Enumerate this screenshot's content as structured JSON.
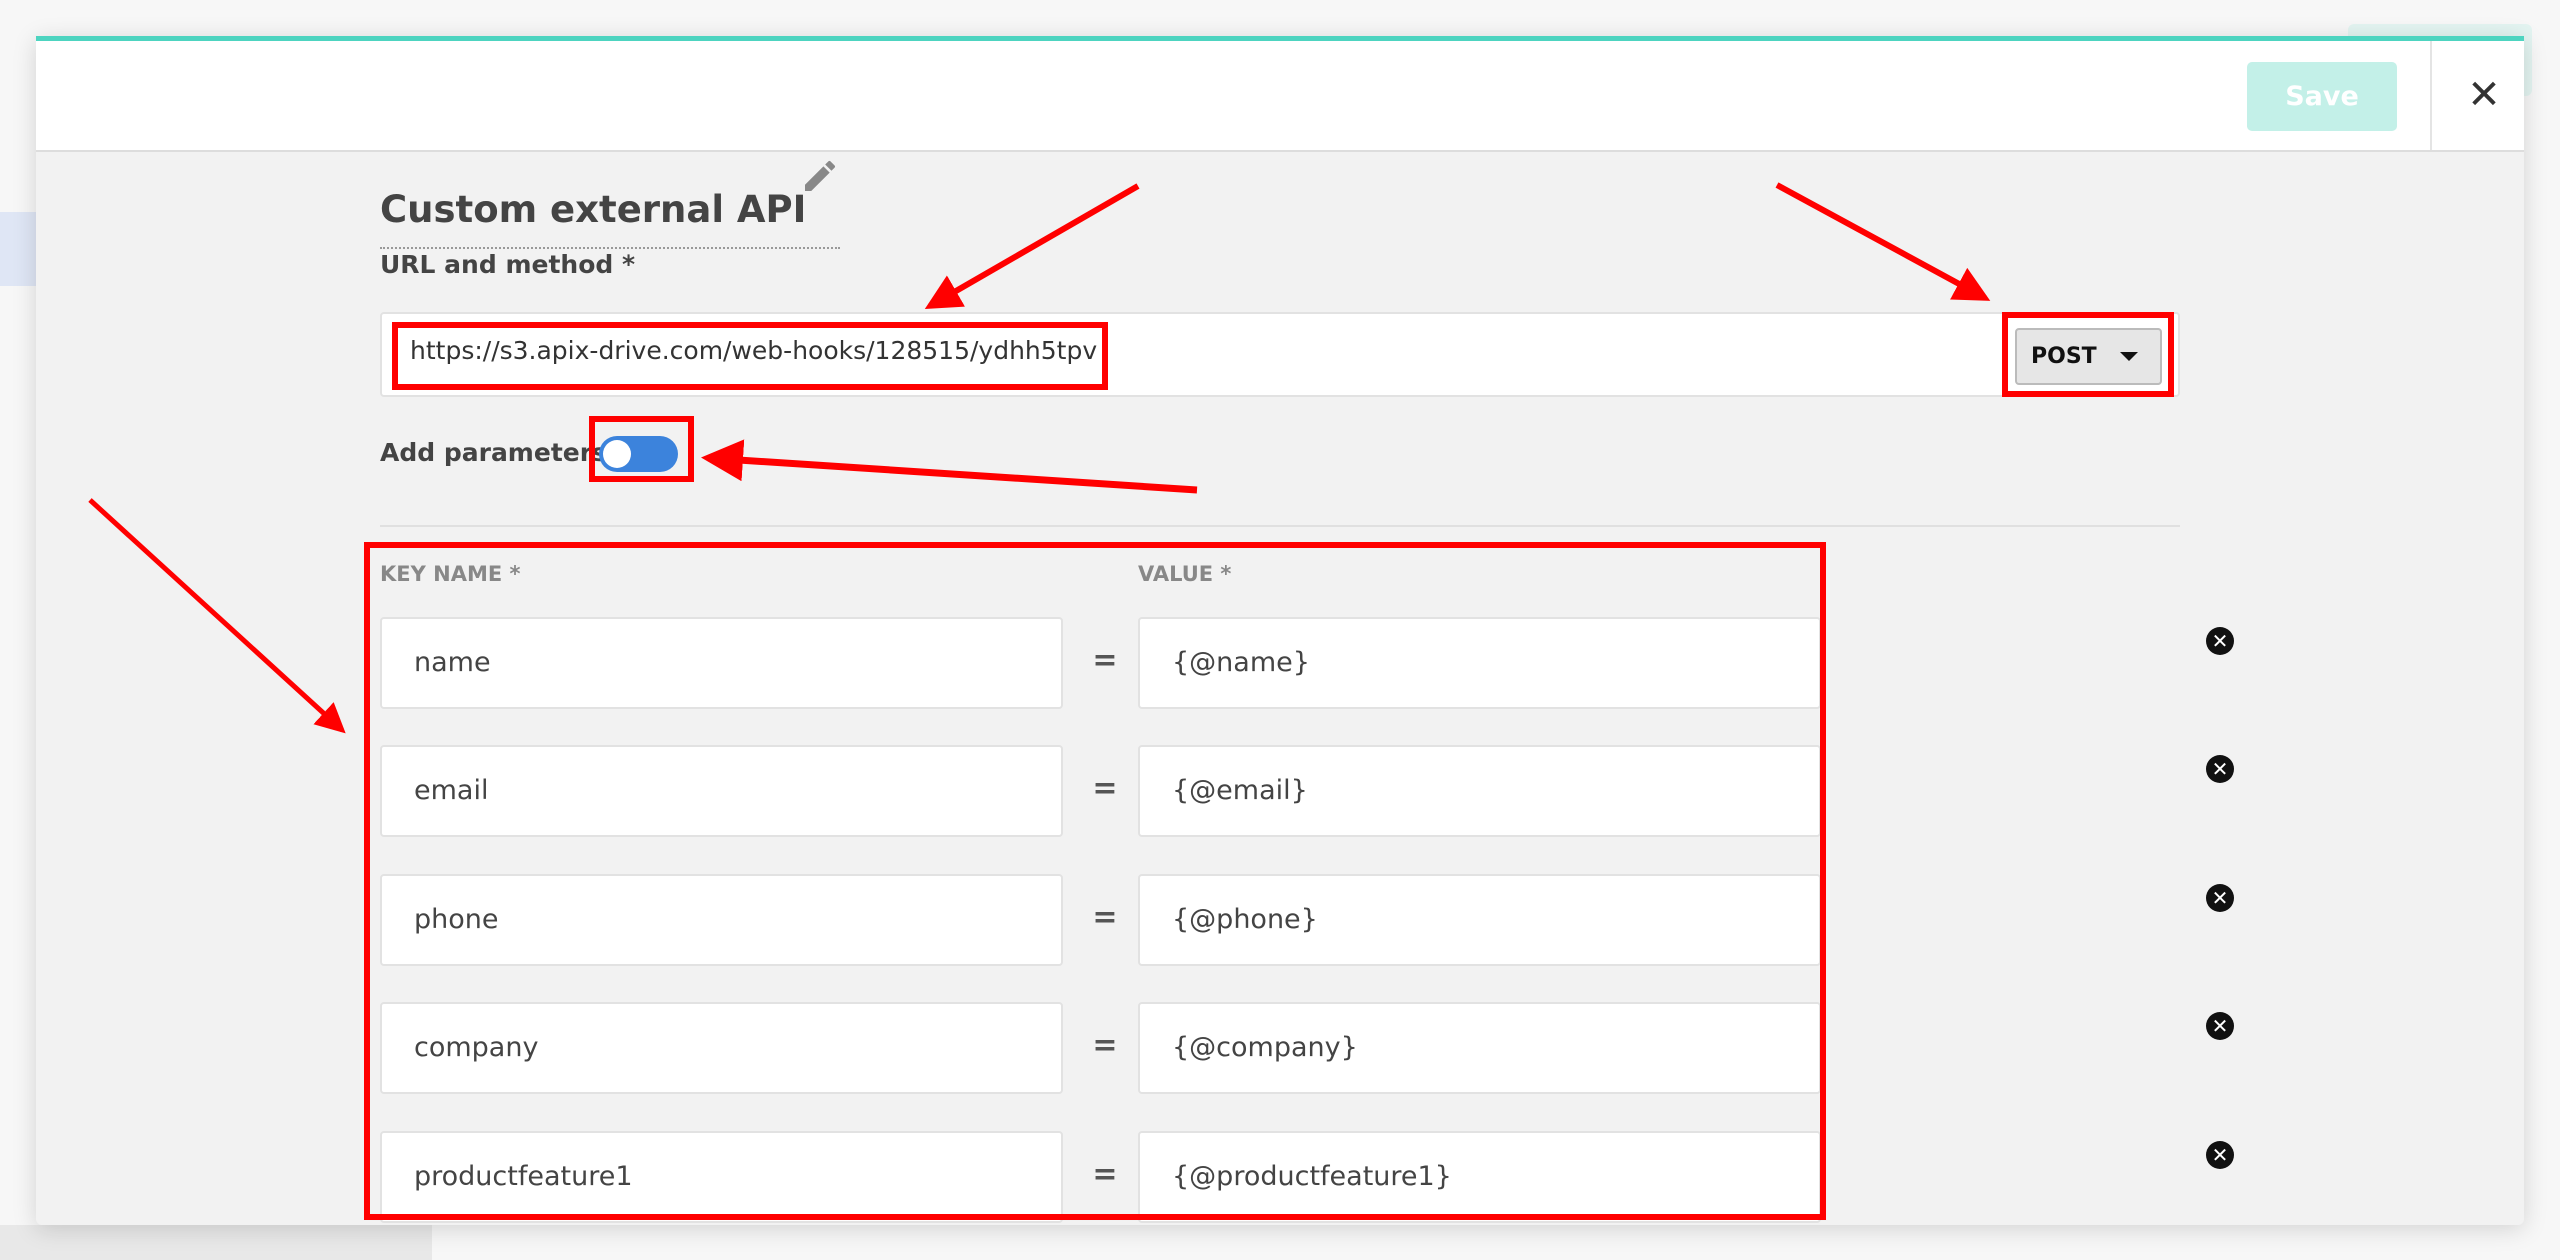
{
  "header": {
    "save_label": "Save",
    "close_icon": "close-icon"
  },
  "form": {
    "title": "Custom external API",
    "url_label": "URL and method *",
    "url_value": "https://s3.apix-drive.com/web-hooks/128515/ydhh5tpv",
    "method": "POST",
    "add_params_label": "Add parameters",
    "add_params_on": true,
    "key_header": "KEY NAME *",
    "value_header": "VALUE *",
    "equals": "=",
    "params": [
      {
        "key": "name",
        "value": "{@name}"
      },
      {
        "key": "email",
        "value": "{@email}"
      },
      {
        "key": "phone",
        "value": "{@phone}"
      },
      {
        "key": "company",
        "value": "{@company}"
      },
      {
        "key": "productfeature1",
        "value": "{@productfeature1}"
      }
    ]
  },
  "colors": {
    "accent": "#4dd4c0",
    "toggle": "#3c83dc",
    "annotation": "#ff0000",
    "save_disabled": "#c3f0e8"
  }
}
